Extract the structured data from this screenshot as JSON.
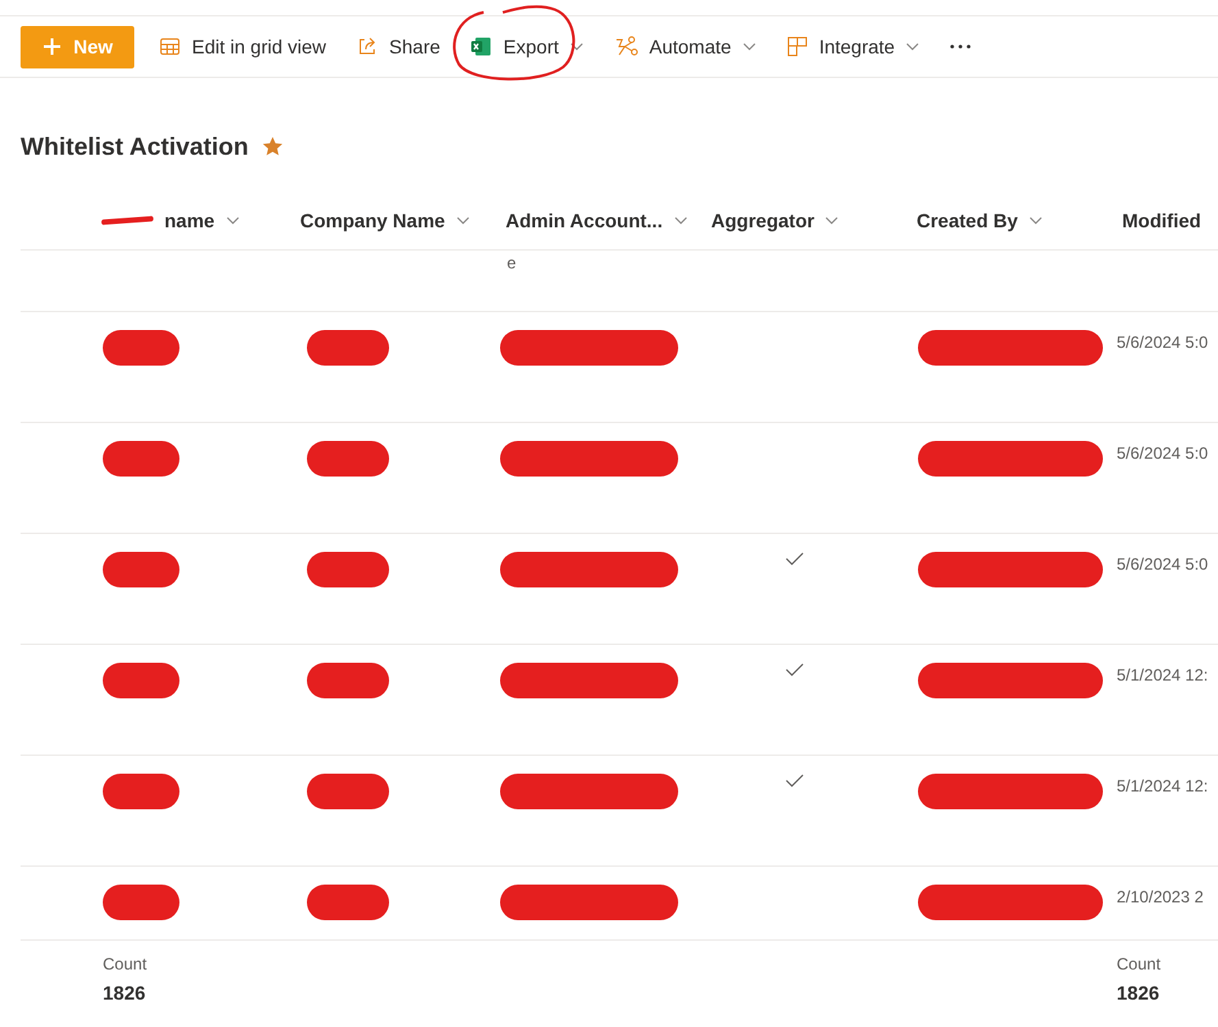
{
  "toolbar": {
    "new_button": {
      "label": "New"
    },
    "items": [
      {
        "kind": "grid",
        "label": "Edit in grid view",
        "dropdown": false,
        "circled": false
      },
      {
        "kind": "share",
        "label": "Share",
        "dropdown": false,
        "circled": false
      },
      {
        "kind": "excel",
        "label": "Export",
        "dropdown": true,
        "circled": true
      },
      {
        "kind": "automate",
        "label": "Automate",
        "dropdown": true,
        "circled": false
      },
      {
        "kind": "integrate",
        "label": "Integrate",
        "dropdown": true,
        "circled": false
      },
      {
        "kind": "more",
        "dropdown": false,
        "circled": false
      }
    ]
  },
  "list": {
    "title": "Whitelist Activation",
    "favorite": true
  },
  "table": {
    "columns": [
      {
        "label": "name",
        "kind": "text",
        "redacted": true,
        "sortable": true,
        "count": {
          "label": "Count",
          "value": "1826"
        }
      },
      {
        "label": "Company Name",
        "kind": "text",
        "redacted": false,
        "sortable": true
      },
      {
        "label": "Admin Account...",
        "kind": "text",
        "redacted": false,
        "sortable": true
      },
      {
        "label": "Aggregator",
        "kind": "check",
        "redacted": false,
        "sortable": true
      },
      {
        "label": "Created By",
        "kind": "text",
        "redacted": false,
        "sortable": true
      },
      {
        "label": "Modified",
        "kind": "text",
        "redacted": false,
        "sortable": false,
        "count": {
          "label": "Count",
          "value": "1826"
        }
      }
    ],
    "rows": [
      {
        "cells": [
          {
            "redacted": false
          },
          {
            "redacted": false
          },
          {
            "text": "e",
            "redacted": false
          },
          {
            "checked": false
          },
          {
            "redacted": false
          },
          {
            "redacted": false
          }
        ]
      },
      {
        "cells": [
          {
            "redacted": true
          },
          {
            "redacted": true
          },
          {
            "redacted": true
          },
          {
            "checked": false
          },
          {
            "redacted": true
          },
          {
            "text": "5/6/2024 5:0",
            "redacted": false
          }
        ]
      },
      {
        "cells": [
          {
            "redacted": true
          },
          {
            "redacted": true
          },
          {
            "redacted": true
          },
          {
            "checked": false
          },
          {
            "redacted": true
          },
          {
            "text": "5/6/2024 5:0",
            "redacted": false
          }
        ]
      },
      {
        "cells": [
          {
            "redacted": true
          },
          {
            "redacted": true
          },
          {
            "redacted": true
          },
          {
            "checked": true
          },
          {
            "redacted": true
          },
          {
            "text": "5/6/2024 5:0",
            "redacted": false
          }
        ]
      },
      {
        "cells": [
          {
            "redacted": true
          },
          {
            "redacted": true
          },
          {
            "redacted": true
          },
          {
            "checked": true
          },
          {
            "redacted": true
          },
          {
            "text": "5/1/2024 12:",
            "redacted": false
          }
        ]
      },
      {
        "cells": [
          {
            "redacted": true
          },
          {
            "redacted": true
          },
          {
            "redacted": true
          },
          {
            "checked": true
          },
          {
            "redacted": true
          },
          {
            "text": "5/1/2024 12:",
            "redacted": false
          }
        ]
      },
      {
        "cells": [
          {
            "redacted": true
          },
          {
            "redacted": true
          },
          {
            "redacted": true
          },
          {
            "checked": false
          },
          {
            "redacted": true
          },
          {
            "text": "2/10/2023 2",
            "redacted": false
          }
        ]
      }
    ]
  }
}
